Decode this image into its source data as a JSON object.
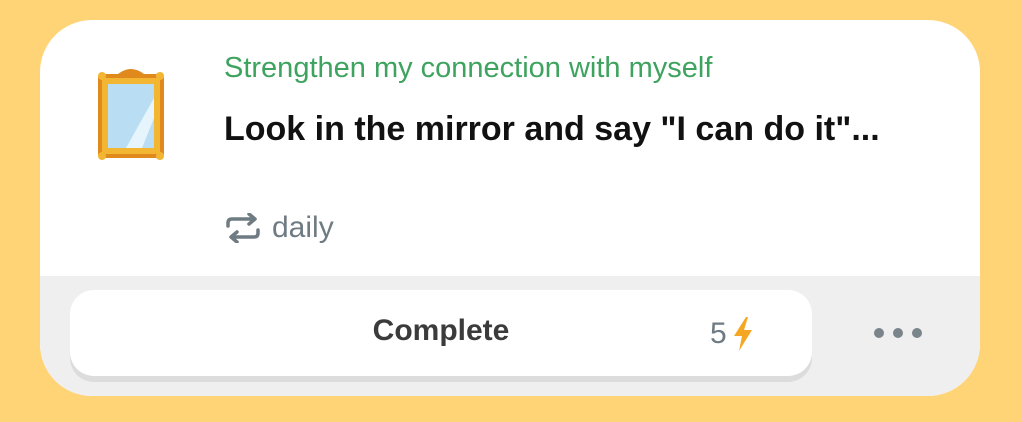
{
  "task": {
    "category": "Strengthen my connection with myself",
    "title": "Look in the mirror and say \"I can do it\"...",
    "frequency": "daily",
    "icon": "mirror-icon"
  },
  "actions": {
    "complete_label": "Complete",
    "points": "5",
    "points_icon": "lightning-bolt-icon",
    "more_icon": "more-options-icon"
  },
  "colors": {
    "background": "#ffd476",
    "category_green": "#3ea35f",
    "bolt_orange": "#f5a623",
    "muted_gray": "#6f7b82"
  }
}
